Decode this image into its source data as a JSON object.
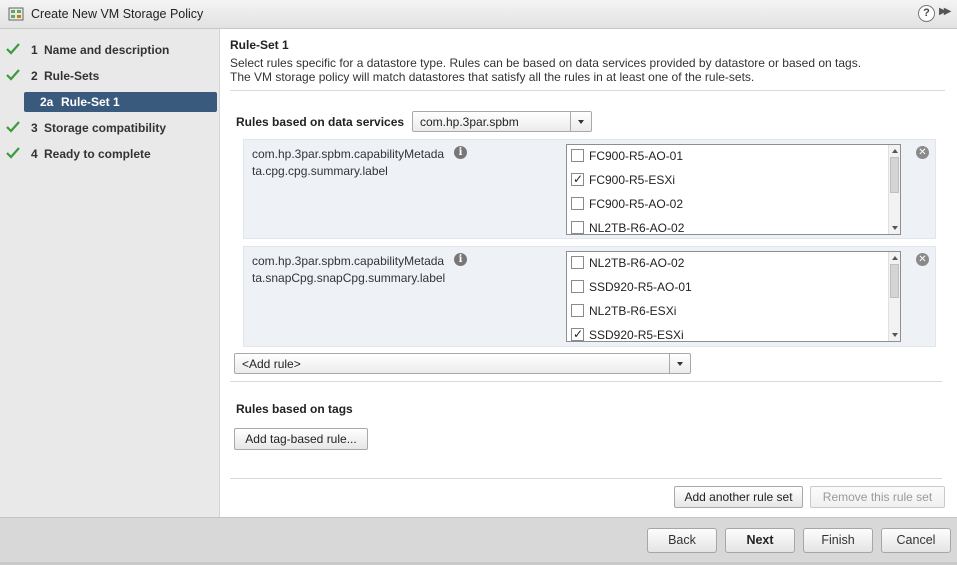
{
  "window": {
    "title": "Create New VM Storage Policy",
    "help_label": "?",
    "expand_label": "▶▶"
  },
  "nav": {
    "items": [
      {
        "num": "1",
        "label": "Name and description",
        "completed": true
      },
      {
        "num": "2",
        "label": "Rule-Sets",
        "completed": true
      },
      {
        "num": "2a",
        "label": "Rule-Set 1",
        "completed": false,
        "active": true
      },
      {
        "num": "3",
        "label": "Storage compatibility",
        "completed": true
      },
      {
        "num": "4",
        "label": "Ready to complete",
        "completed": true
      }
    ]
  },
  "main": {
    "title": "Rule-Set 1",
    "description_line1": "Select rules specific for a datastore type. Rules can be based on data services provided by datastore or based on tags.",
    "description_line2": "The VM storage policy will match datastores that satisfy all the rules in at least one of the rule-sets.",
    "data_services_label": "Rules based on data services",
    "data_services_value": "com.hp.3par.spbm",
    "rules": [
      {
        "name": "com.hp.3par.spbm.capabilityMetadata.cpg.cpg.summary.label",
        "options": [
          {
            "label": "FC900-R5-AO-01",
            "checked": false
          },
          {
            "label": "FC900-R5-ESXi",
            "checked": true
          },
          {
            "label": "FC900-R5-AO-02",
            "checked": false
          },
          {
            "label": "NL2TB-R6-AO-02",
            "checked": false
          }
        ]
      },
      {
        "name": "com.hp.3par.spbm.capabilityMetadata.snapCpg.snapCpg.summary.label",
        "options": [
          {
            "label": "NL2TB-R6-AO-02",
            "checked": false
          },
          {
            "label": "SSD920-R5-AO-01",
            "checked": false
          },
          {
            "label": "NL2TB-R6-ESXi",
            "checked": false
          },
          {
            "label": "SSD920-R5-ESXi",
            "checked": true
          }
        ]
      }
    ],
    "add_rule_label": "<Add rule>",
    "tags_label": "Rules based on tags",
    "add_tag_rule_label": "Add tag-based rule...",
    "add_rule_set_label": "Add another rule set",
    "remove_rule_set_label": "Remove this rule set"
  },
  "footer": {
    "back_label": "Back",
    "next_label": "Next",
    "finish_label": "Finish",
    "cancel_label": "Cancel"
  },
  "icons": {
    "app": "vm-storage-policy-icon",
    "check": "checkmark-icon",
    "info": "info-icon",
    "remove": "remove-icon"
  },
  "colors": {
    "nav_active_bg": "#3a5a7d",
    "check_green": "#3c9a3c",
    "rule_box_bg": "#eef2f6"
  }
}
